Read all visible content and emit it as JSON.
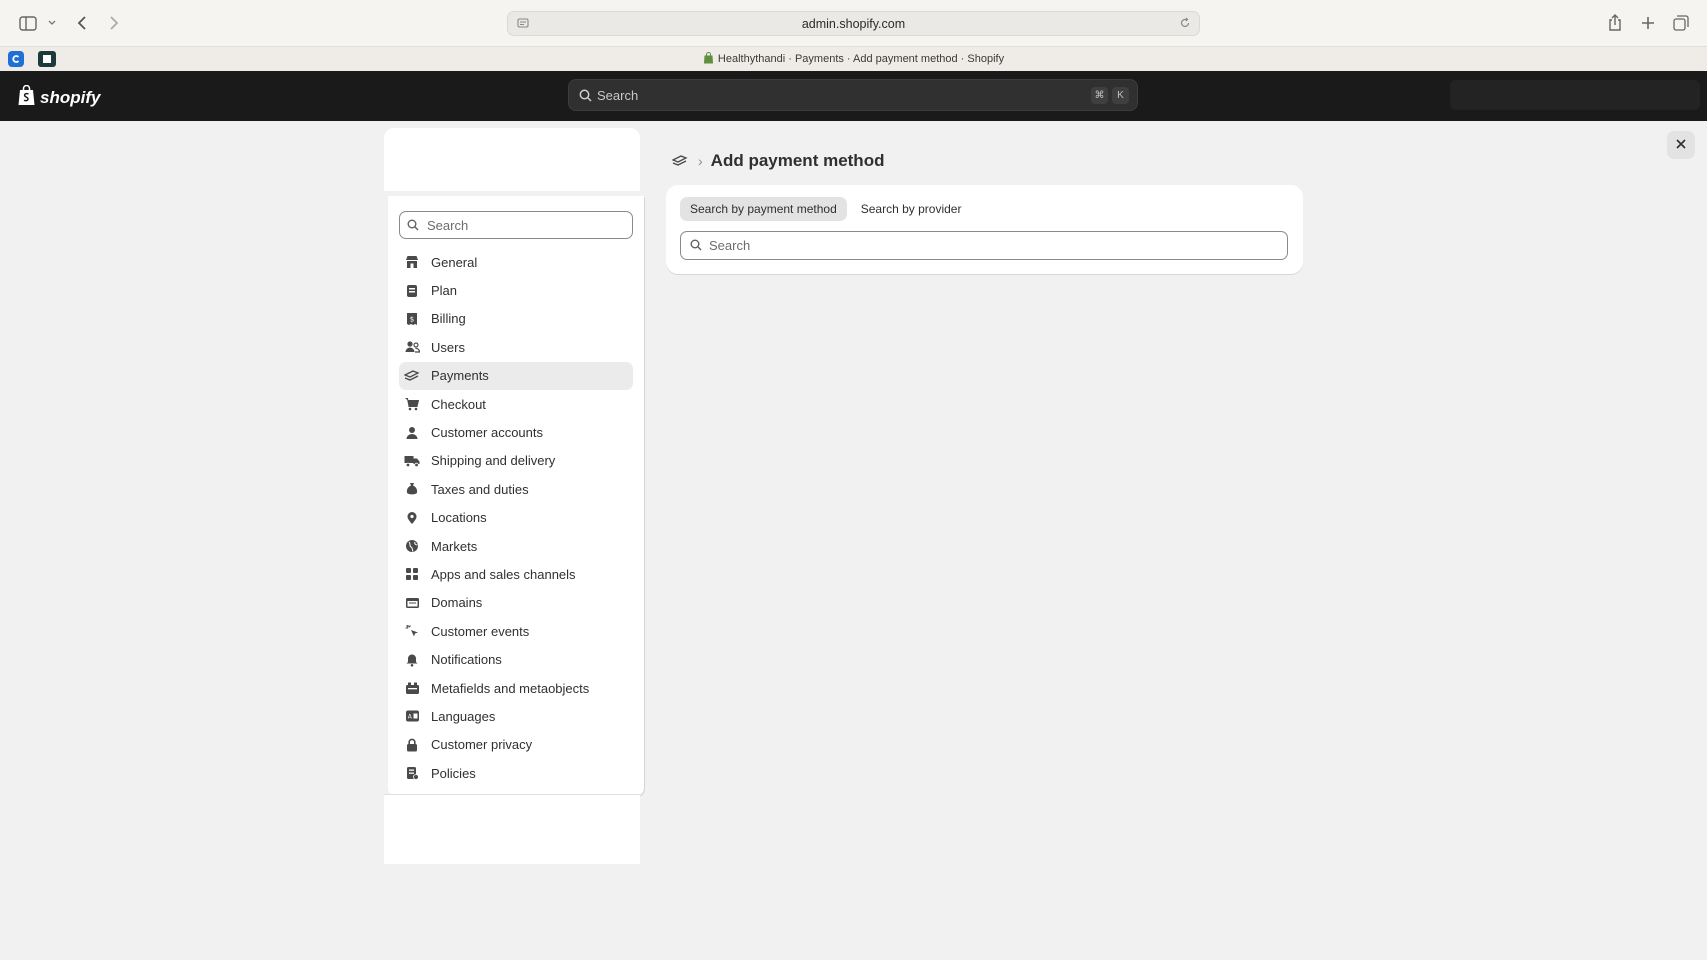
{
  "browser": {
    "url": "admin.shopify.com",
    "tab_title": "Healthythandi · Payments · Add payment method · Shopify"
  },
  "topbar": {
    "brand": "shopify",
    "search_placeholder": "Search",
    "shortcut_keys": [
      "⌘",
      "K"
    ]
  },
  "sidebar": {
    "search_placeholder": "Search",
    "items": [
      {
        "label": "General",
        "icon": "store-icon"
      },
      {
        "label": "Plan",
        "icon": "plan-icon"
      },
      {
        "label": "Billing",
        "icon": "billing-icon"
      },
      {
        "label": "Users",
        "icon": "users-icon"
      },
      {
        "label": "Payments",
        "icon": "payments-icon",
        "active": true
      },
      {
        "label": "Checkout",
        "icon": "cart-icon"
      },
      {
        "label": "Customer accounts",
        "icon": "person-icon"
      },
      {
        "label": "Shipping and delivery",
        "icon": "truck-icon"
      },
      {
        "label": "Taxes and duties",
        "icon": "taxes-icon"
      },
      {
        "label": "Locations",
        "icon": "location-icon"
      },
      {
        "label": "Markets",
        "icon": "globe-icon"
      },
      {
        "label": "Apps and sales channels",
        "icon": "apps-icon"
      },
      {
        "label": "Domains",
        "icon": "domain-icon"
      },
      {
        "label": "Customer events",
        "icon": "cursor-icon"
      },
      {
        "label": "Notifications",
        "icon": "bell-icon"
      },
      {
        "label": "Metafields and metaobjects",
        "icon": "metafields-icon"
      },
      {
        "label": "Languages",
        "icon": "language-icon"
      },
      {
        "label": "Customer privacy",
        "icon": "lock-icon"
      },
      {
        "label": "Policies",
        "icon": "policy-icon"
      }
    ]
  },
  "main": {
    "title": "Add payment method",
    "tabs": [
      {
        "label": "Search by payment method",
        "active": true
      },
      {
        "label": "Search by provider",
        "active": false
      }
    ],
    "search_placeholder": "Search"
  }
}
